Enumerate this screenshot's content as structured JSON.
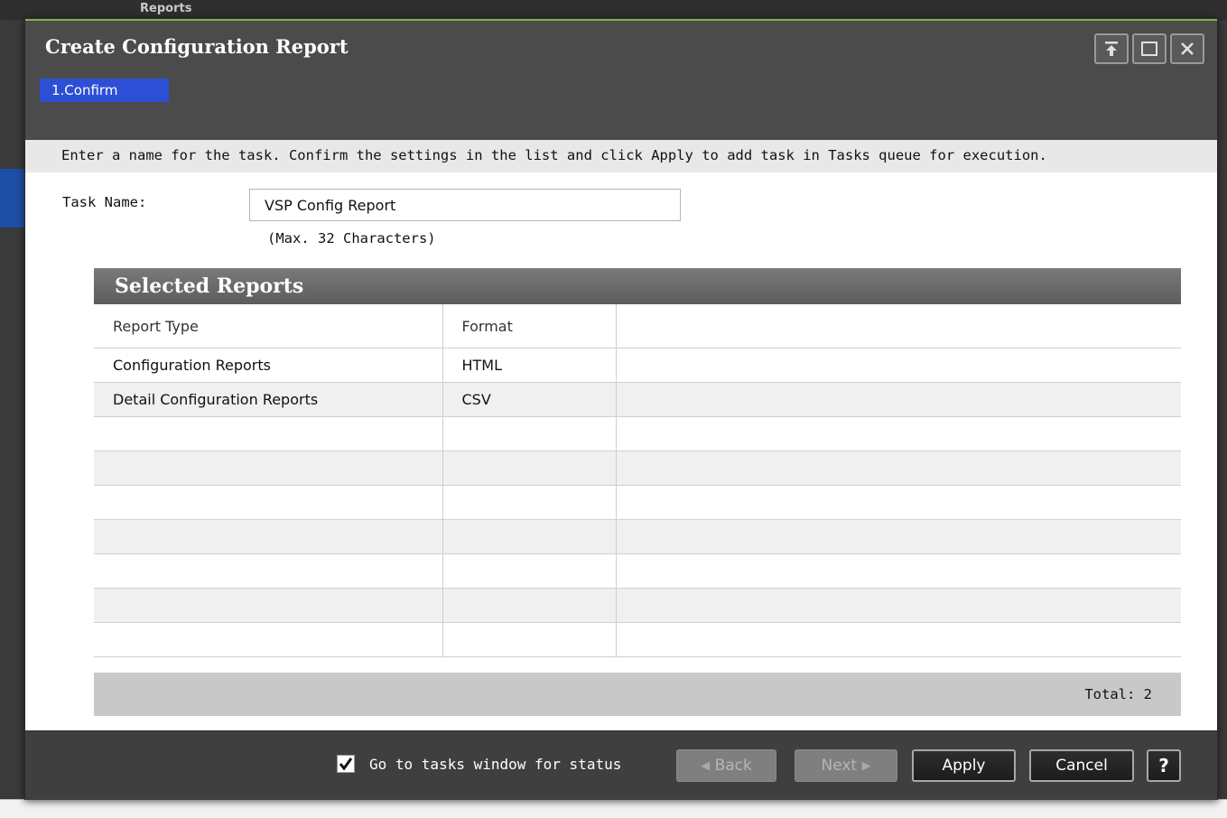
{
  "background": {
    "title": "Reports"
  },
  "dialog": {
    "title": "Create Configuration Report",
    "step": "1.Confirm",
    "instructions": "Enter a name for the task. Confirm the settings in the list and click Apply to add task in Tasks queue for execution.",
    "task_name_label": "Task Name:",
    "task_name_value": "VSP Config Report",
    "task_name_hint": "(Max. 32 Characters)"
  },
  "selected_reports": {
    "title": "Selected Reports",
    "columns": [
      "Report Type",
      "Format",
      ""
    ],
    "rows": [
      [
        "Configuration Reports",
        "HTML",
        ""
      ],
      [
        "Detail Configuration Reports",
        "CSV",
        ""
      ],
      [
        "",
        "",
        ""
      ],
      [
        "",
        "",
        ""
      ],
      [
        "",
        "",
        ""
      ],
      [
        "",
        "",
        ""
      ],
      [
        "",
        "",
        ""
      ],
      [
        "",
        "",
        ""
      ],
      [
        "",
        "",
        ""
      ]
    ],
    "total_label": "Total:  2"
  },
  "footer": {
    "checkbox_label": "Go to tasks window for status",
    "checkbox_checked": true,
    "back_label": "Back",
    "next_label": "Next",
    "apply_label": "Apply",
    "cancel_label": "Cancel",
    "help_label": "?"
  },
  "icons": {
    "pin": "pin-icon",
    "maximize": "maximize-icon",
    "close": "close-icon",
    "check": "checkmark-icon",
    "back_arrow": "left-arrow-icon",
    "next_arrow": "right-arrow-icon"
  }
}
